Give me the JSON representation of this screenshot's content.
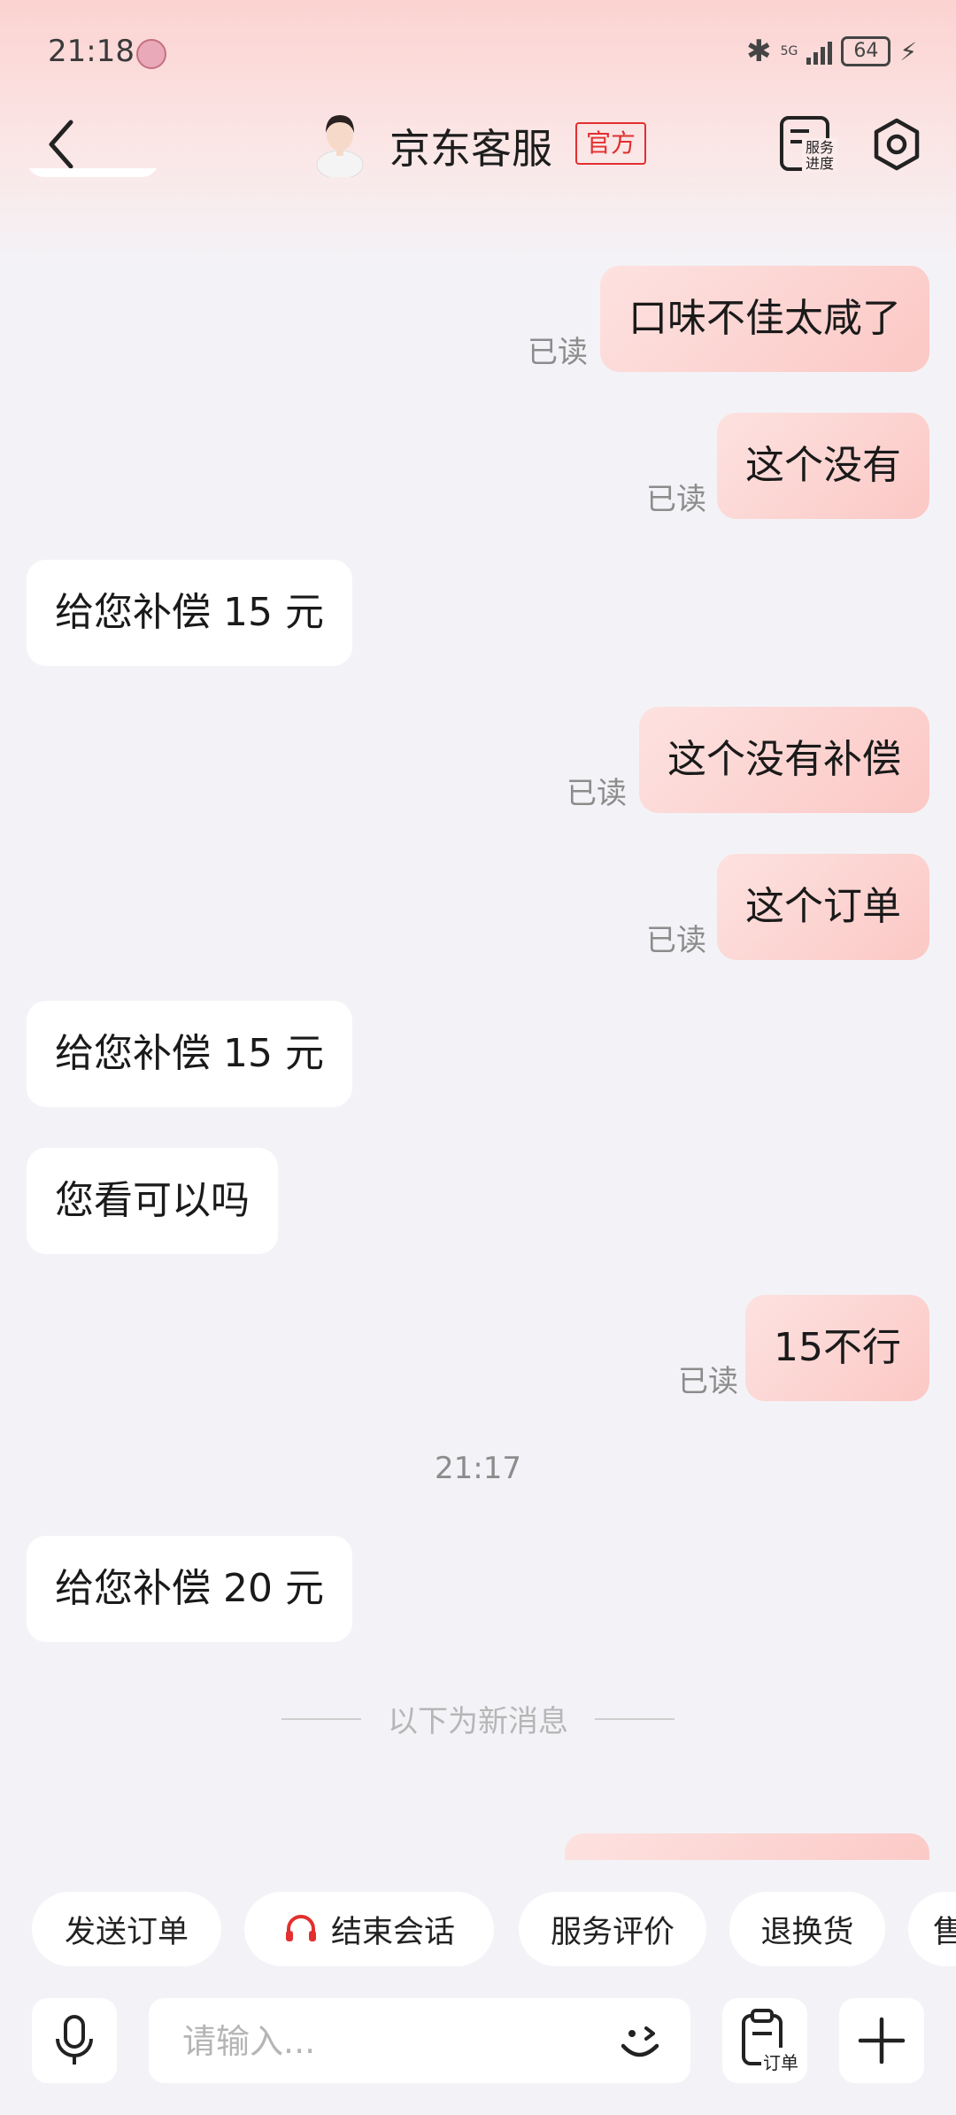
{
  "status_bar": {
    "time": "21:18",
    "network": "5G",
    "battery": "64"
  },
  "header": {
    "title": "京东客服",
    "badge": "官方",
    "service_progress": "服务进度"
  },
  "chat": {
    "messages": [
      {
        "direction": "out",
        "text": "口味不佳太咸了",
        "status": "已读"
      },
      {
        "direction": "out",
        "text": "这个没有",
        "status": "已读"
      },
      {
        "direction": "in",
        "text": "给您补偿 15 元"
      },
      {
        "direction": "out",
        "text": "这个没有补偿",
        "status": "已读"
      },
      {
        "direction": "out",
        "text": "这个订单",
        "status": "已读"
      },
      {
        "direction": "in",
        "text": "给您补偿 15 元"
      },
      {
        "direction": "in",
        "text": "您看可以吗"
      },
      {
        "direction": "out",
        "text": "15不行",
        "status": "已读"
      },
      {
        "direction": "in",
        "text": "给您补偿 20 元"
      }
    ],
    "timestamp": "21:17",
    "new_messages_divider": "以下为新消息"
  },
  "quick_actions": [
    "发送订单",
    "结束会话",
    "服务评价",
    "退换货",
    "售"
  ],
  "input": {
    "placeholder": "请输入...",
    "order_label": "订单"
  },
  "colors": {
    "accent": "#e22f2f",
    "outgoing_bubble": "#fbd0cd",
    "background": "#f3f3f7"
  }
}
